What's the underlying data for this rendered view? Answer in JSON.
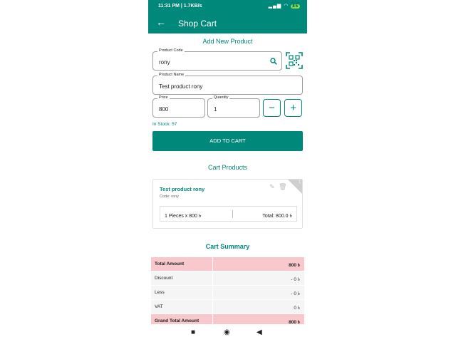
{
  "status_bar": {
    "time": "11:31 PM | 1.7KB/s",
    "battery": "85"
  },
  "app_bar": {
    "title": "Shop Cart"
  },
  "add_product": {
    "section_title": "Add New Product",
    "product_code_label": "Product Code",
    "product_code_value": "rony",
    "product_name_label": "Product Name",
    "product_name_value": "Test product rony",
    "price_label": "Price",
    "price_value": "800",
    "quantity_label": "Quantity",
    "quantity_value": "1",
    "minus_label": "−",
    "plus_label": "+",
    "in_stock": "In Stock: 57",
    "add_button": "ADD TO CART"
  },
  "cart": {
    "section_title": "Cart Products",
    "items": [
      {
        "name": "Test product rony",
        "code": "Code: rony",
        "qty_price": "1 Pieces x 800 ৳",
        "total": "Total: 800.0 ৳",
        "index": "1"
      }
    ]
  },
  "summary": {
    "section_title": "Cart Summary",
    "rows": [
      {
        "label": "Total Amount",
        "value": "800 ৳"
      },
      {
        "label": "Discount",
        "value": "- 0 ৳"
      },
      {
        "label": "Less",
        "value": "- 0 ৳"
      },
      {
        "label": "VAT",
        "value": "0 ৳"
      },
      {
        "label": "Grand Total Amount",
        "value": "800 ৳"
      }
    ]
  },
  "colors": {
    "primary": "#00897b",
    "highlight_row": "#f8c8cc"
  }
}
